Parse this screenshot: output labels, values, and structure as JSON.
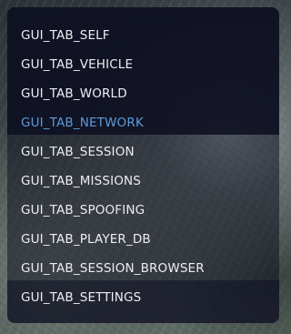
{
  "menu": {
    "items": [
      {
        "label": "GUI_TAB_SELF",
        "active": false
      },
      {
        "label": "GUI_TAB_VEHICLE",
        "active": false
      },
      {
        "label": "GUI_TAB_WORLD",
        "active": false
      },
      {
        "label": "GUI_TAB_NETWORK",
        "active": true
      },
      {
        "label": "GUI_TAB_SESSION",
        "active": false
      },
      {
        "label": "GUI_TAB_MISSIONS",
        "active": false
      },
      {
        "label": "GUI_TAB_SPOOFING",
        "active": false
      },
      {
        "label": "GUI_TAB_PLAYER_DB",
        "active": false
      },
      {
        "label": "GUI_TAB_SESSION_BROWSER",
        "active": false
      },
      {
        "label": "GUI_TAB_SETTINGS",
        "active": false
      }
    ]
  },
  "colors": {
    "active_text": "#5d9ad8",
    "text": "#ecedf2",
    "panel": "#0e1022"
  }
}
